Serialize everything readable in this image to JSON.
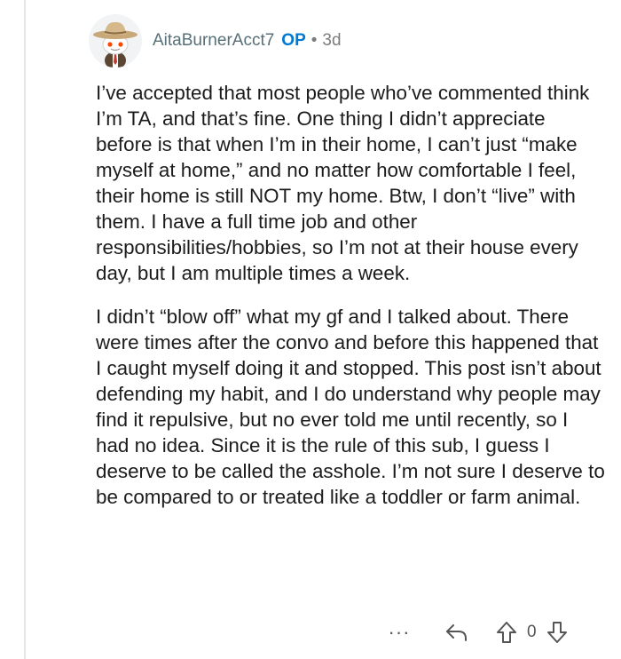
{
  "comment": {
    "username": "AitaBurnerAcct7",
    "op_badge": "OP",
    "separator": "•",
    "age": "3d",
    "paragraphs": [
      "I’ve accepted that most people who’ve commented think I’m TA, and that’s fine. One thing I didn’t appreciate before is that when I’m in their home, I can’t just “make myself at home,” and no matter how comfortable I feel, their home is still NOT my home. Btw, I don’t “live” with them. I have a full time job and other responsibilities/hobbies, so I’m not at their house every day, but I am multiple times a week.",
      "I didn’t “blow off” what my gf and I talked about. There were times after the convo and before this happened that I caught myself doing it and stopped. This post isn’t about defending my habit, and I do understand why people may find it repulsive, but no ever told me until recently, so I had no idea. Since it is the rule of this sub, I guess I deserve to be called the asshole. I’m not sure I deserve to be compared to or treated like a toddler or farm animal."
    ]
  },
  "actions": {
    "more_label": "···",
    "score": "0"
  },
  "colors": {
    "op_badge": "#0079d3",
    "username": "#576f76",
    "text": "#1c1c1c",
    "muted": "#7c7c7c",
    "avatar_bg": "#f1f3f4",
    "snoo_face": "#ff4500"
  },
  "icons": {
    "avatar": "snoo-with-cowboy-hat",
    "reply": "reply-arrow-icon",
    "upvote": "upvote-arrow-icon",
    "downvote": "downvote-arrow-icon"
  }
}
